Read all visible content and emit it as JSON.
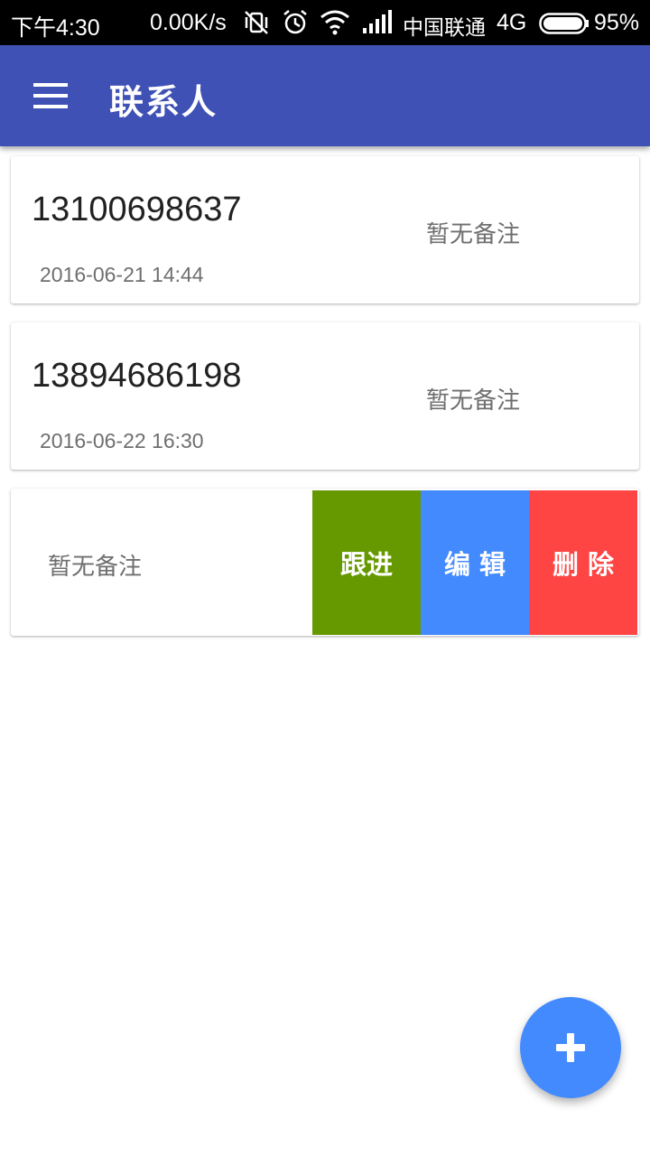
{
  "status_bar": {
    "time": "下午4:30",
    "speed": "0.00K/s",
    "carrier": "中国联通",
    "network": "4G",
    "battery_pct": "95%",
    "battery_level": 0.95,
    "icons": [
      "vibrate-off-icon",
      "alarm-icon",
      "wifi-icon",
      "signal-icon",
      "battery-icon"
    ]
  },
  "app_bar": {
    "title": "联系人",
    "menu_icon": "menu-icon",
    "color": "#3f51b5"
  },
  "contacts": [
    {
      "phone": "13100698637",
      "date": "2016-06-21 14:44",
      "note": "暂无备注"
    },
    {
      "phone": "13894686198",
      "date": "2016-06-22 16:30",
      "note": "暂无备注"
    },
    {
      "note": "暂无备注"
    }
  ],
  "swipe_actions": {
    "follow_label": "跟进",
    "edit_label": "编 辑",
    "delete_label": "删 除",
    "follow_color": "#669900",
    "edit_color": "#448aff",
    "delete_color": "#ff4444"
  },
  "fab": {
    "icon": "plus-icon",
    "color": "#448aff"
  }
}
